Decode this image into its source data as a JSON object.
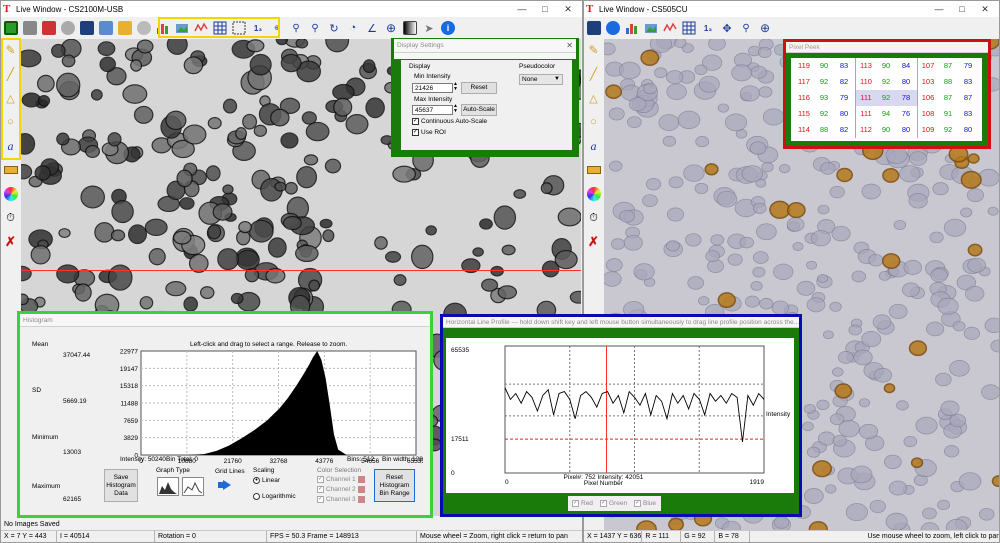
{
  "colors": {
    "accent_green": "#1a7a0a",
    "accent_blue": "#0a0ab4",
    "accent_red": "#d01010",
    "accent_yellow": "#f5d400",
    "lime": "#3ad23a"
  },
  "left_window": {
    "title": "Live Window - CS2100M-USB",
    "status": {
      "no_images": "No Images Saved",
      "xy": "X = 7  Y = 443",
      "intensity": "I = 40514",
      "rotation": "Rotation = 0",
      "fps": "FPS = 50.3  Frame = 148913",
      "hint": "Mouse wheel = Zoom, right click = return to pan"
    }
  },
  "right_window": {
    "title": "Live Window - CS505CU",
    "status": {
      "xy": "X = 1437  Y = 636",
      "r": "R = 111",
      "g": "G = 92",
      "b": "B = 78",
      "hint": "Use mouse wheel to zoom, left click to pan"
    }
  },
  "display_settings": {
    "title": "Display Settings",
    "display_label": "Display",
    "min_label": "Min Intensity",
    "min_value": "21426",
    "max_label": "Max Intensity",
    "max_value": "45637",
    "reset": "Reset",
    "auto_scale": "Auto-Scale",
    "continuous": "Continuous Auto-Scale",
    "use_roi": "Use ROI",
    "pseudocolor_label": "Pseudocolor",
    "pseudocolor_value": "None"
  },
  "pixel_peek": {
    "title": "Pixel Peek",
    "rows": [
      [
        [
          119,
          90,
          83
        ],
        [
          113,
          90,
          84
        ],
        [
          107,
          87,
          79
        ]
      ],
      [
        [
          117,
          92,
          82
        ],
        [
          110,
          92,
          80
        ],
        [
          103,
          88,
          83
        ]
      ],
      [
        [
          116,
          93,
          79
        ],
        [
          111,
          92,
          78
        ],
        [
          106,
          87,
          87
        ]
      ],
      [
        [
          115,
          92,
          80
        ],
        [
          111,
          94,
          76
        ],
        [
          108,
          91,
          83
        ]
      ],
      [
        [
          114,
          88,
          82
        ],
        [
          112,
          90,
          80
        ],
        [
          109,
          92,
          80
        ]
      ]
    ]
  },
  "histogram": {
    "title": "Histogram",
    "instruction": "Left-click and drag to select a range.  Release to zoom.",
    "mean_label": "Mean",
    "mean": "37047.44",
    "sd_label": "SD",
    "sd": "5669.19",
    "min_label": "Minimum",
    "min": "13003",
    "max_label": "Maximum",
    "max": "62165",
    "yticks": [
      "22977",
      "19147",
      "15318",
      "11488",
      "7659",
      "3829",
      "0"
    ],
    "xticks": [
      "0",
      "10880",
      "21760",
      "32768",
      "43776",
      "54656",
      "65535"
    ],
    "footer": {
      "intensity": "Intensity: 50240",
      "bin_total": "Bin Total: 0",
      "bins": "Bins: 512",
      "bin_width": "Bin width: 128"
    },
    "save_button": "Save Histogram Data",
    "graph_type_label": "Graph Type",
    "grid_lines_label": "Grid Lines",
    "scaling_label": "Scaling",
    "linear": "Linear",
    "log": "Logarithmic",
    "color_selection_label": "Color Selection",
    "channels": [
      "Channel 1",
      "Channel 2",
      "Channel 3"
    ],
    "reset_button": "Reset Histogram Bin Range"
  },
  "line_profile": {
    "title": "Horizontal Line Profile --- hold down shift key and left mouse button simultaneously to drag line profile position across the...",
    "y_top": "65535",
    "y_ref": "17511",
    "y_bottom": "0",
    "x_left": "0",
    "x_right": "1919",
    "pixel_readout": "Pixel#: 752   Intensity: 42051",
    "x_axis_label": "Pixel Number",
    "y_axis_label": "Intensity",
    "channels": [
      "Red",
      "Green",
      "Blue"
    ]
  },
  "chart_data": [
    {
      "type": "area",
      "title": "Histogram",
      "xlabel": "",
      "ylabel": "",
      "xlim": [
        0,
        65535
      ],
      "ylim": [
        0,
        22977
      ],
      "x": [
        0,
        10880,
        15000,
        18000,
        21000,
        24000,
        27000,
        30000,
        33000,
        35000,
        37000,
        38500,
        40000,
        41000,
        42000,
        43000,
        44000,
        45000,
        46000,
        47000,
        49000,
        65535
      ],
      "values": [
        0,
        0,
        200,
        900,
        2100,
        3700,
        5500,
        7600,
        10300,
        12600,
        15300,
        17500,
        19800,
        21600,
        22977,
        21000,
        17000,
        11000,
        4500,
        1200,
        0,
        0
      ]
    },
    {
      "type": "line",
      "title": "Horizontal Line Profile",
      "xlabel": "Pixel Number",
      "ylabel": "Intensity",
      "xlim": [
        0,
        1919
      ],
      "ylim": [
        0,
        65535
      ],
      "x": [
        0,
        40,
        80,
        120,
        160,
        200,
        240,
        280,
        320,
        360,
        400,
        440,
        480,
        520,
        560,
        600,
        640,
        680,
        720,
        760,
        800,
        840,
        880,
        920,
        960,
        1000,
        1040,
        1080,
        1120,
        1160,
        1200,
        1240,
        1280,
        1320,
        1360,
        1400,
        1440,
        1480,
        1520,
        1560,
        1600,
        1640,
        1680,
        1720,
        1760,
        1800,
        1840,
        1880,
        1919
      ],
      "values": [
        44000,
        38000,
        41000,
        36000,
        42000,
        39000,
        32000,
        40000,
        43000,
        30000,
        41000,
        42000,
        38000,
        28000,
        40000,
        42000,
        39000,
        34000,
        41000,
        42000,
        36000,
        40000,
        31000,
        42000,
        39000,
        35000,
        41000,
        30000,
        40000,
        37000,
        28000,
        41000,
        36000,
        40000,
        33000,
        41000,
        38000,
        30000,
        41000,
        37000,
        40000,
        36000,
        41000,
        39000,
        16000,
        40000,
        35000,
        41000,
        38000
      ]
    }
  ]
}
